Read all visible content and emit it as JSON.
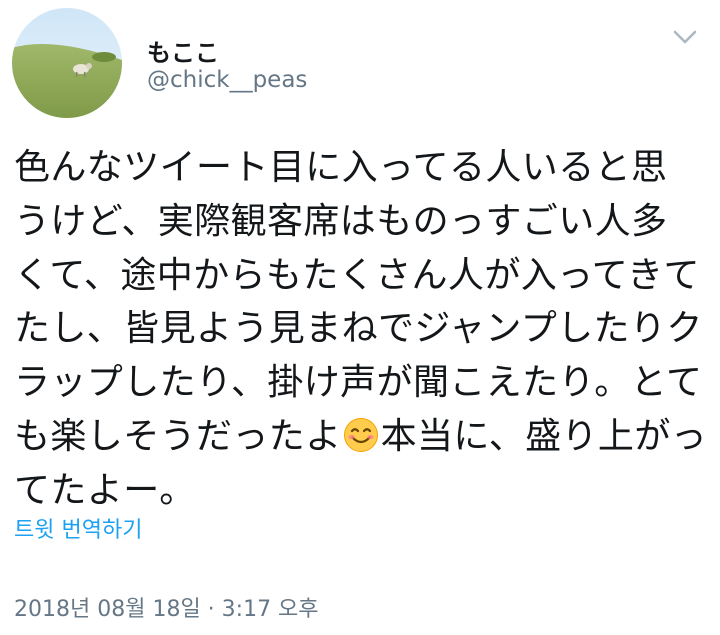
{
  "user": {
    "display_name": "もここ",
    "handle": "@chick__peas"
  },
  "tweet": {
    "lines": [
      "色んなツイート目に入ってる人いると思",
      "うけど、実際観客席はものっすごい人多",
      "くて、途中からもたくさん人が入ってきて",
      "たし、皆見よう見まねでジャンプしたりク",
      "ラップしたり、掛け声が聞こえたり。とて",
      "も楽しそうだったよ",
      "本当に、盛り上がっ",
      "てたよー。"
    ],
    "emoji": "smiling-face-with-smiling-eyes"
  },
  "translate": {
    "label": "트윗 번역하기"
  },
  "timestamp": "2018년 08월 18일 · 3:17 오후",
  "colors": {
    "link": "#1da1f2",
    "secondary": "#657786",
    "text": "#14171a"
  }
}
